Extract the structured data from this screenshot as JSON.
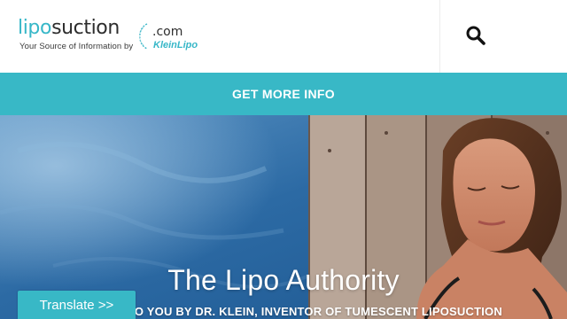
{
  "logo": {
    "word_lipo": "lipo",
    "word_suction": "suction",
    "tagline": "Your Source of Information by",
    "com": ".com",
    "partner": "KleinLipo"
  },
  "header": {
    "search_icon": "search-icon"
  },
  "cta": {
    "label": "GET MORE INFO"
  },
  "hero": {
    "title": "The Lipo Authority",
    "subtitle": "BROUGHT TO YOU BY DR. KLEIN, INVENTOR OF TUMESCENT LIPOSUCTION",
    "image": "woman-sunbathing-on-wooden-dock"
  },
  "translate": {
    "label": "Translate >>"
  },
  "colors": {
    "accent": "#38b8c6",
    "logo_dark": "#2d2d2d",
    "white": "#ffffff"
  }
}
